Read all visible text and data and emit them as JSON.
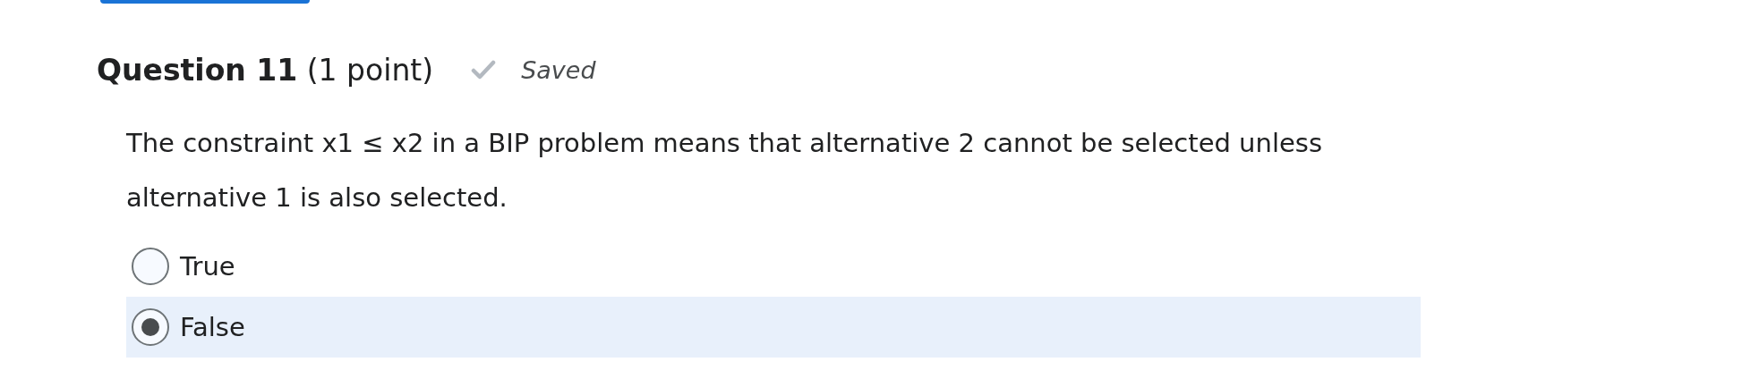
{
  "question": {
    "title": "Question 11",
    "points": "(1 point)",
    "status": "Saved",
    "text": "The constraint x1 ≤ x2 in a BIP problem means that alternative 2 cannot be selected unless alternative 1 is also selected."
  },
  "options": [
    {
      "label": "True",
      "selected": false
    },
    {
      "label": "False",
      "selected": true
    }
  ]
}
